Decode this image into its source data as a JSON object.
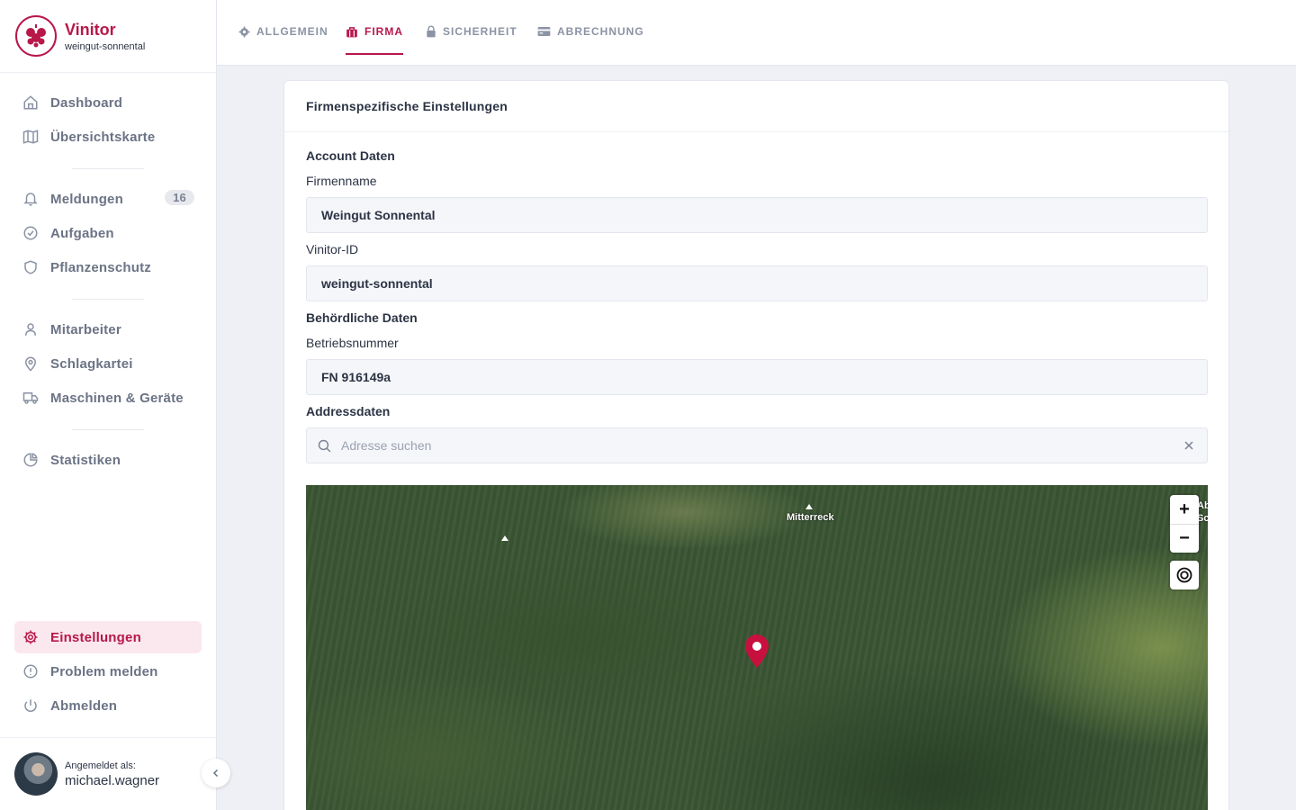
{
  "brand": {
    "name": "Vinitor",
    "account": "weingut-sonnental",
    "logo_icon": "grapes-icon"
  },
  "sidebar": {
    "items": [
      {
        "label": "Dashboard",
        "icon": "home-icon"
      },
      {
        "label": "Übersichtskarte",
        "icon": "map-icon"
      },
      {
        "label": "Meldungen",
        "icon": "bell-icon",
        "badge": "16"
      },
      {
        "label": "Aufgaben",
        "icon": "check-circle-icon"
      },
      {
        "label": "Pflanzenschutz",
        "icon": "shield-icon"
      },
      {
        "label": "Mitarbeiter",
        "icon": "user-icon"
      },
      {
        "label": "Schlagkartei",
        "icon": "location-pin-icon"
      },
      {
        "label": "Maschinen & Geräte",
        "icon": "truck-icon"
      },
      {
        "label": "Statistiken",
        "icon": "pie-chart-icon"
      }
    ],
    "bottom_items": [
      {
        "label": "Einstellungen",
        "icon": "gear-icon",
        "active": true
      },
      {
        "label": "Problem melden",
        "icon": "alert-circle-icon"
      },
      {
        "label": "Abmelden",
        "icon": "power-icon"
      }
    ],
    "user": {
      "caption": "Angemeldet als:",
      "name": "michael.wagner"
    }
  },
  "tabs": [
    {
      "label": "ALLGEMEIN",
      "icon": "gear-icon"
    },
    {
      "label": "FIRMA",
      "icon": "briefcase-icon",
      "active": true
    },
    {
      "label": "SICHERHEIT",
      "icon": "lock-icon"
    },
    {
      "label": "ABRECHNUNG",
      "icon": "credit-card-icon"
    }
  ],
  "card": {
    "title": "Firmenspezifische Einstellungen",
    "account_section": "Account Daten",
    "company_name_label": "Firmenname",
    "company_name_value": "Weingut Sonnental",
    "vinitor_id_label": "Vinitor-ID",
    "vinitor_id_value": "weingut-sonnental",
    "authority_section": "Behördliche Daten",
    "business_number_label": "Betriebsnummer",
    "business_number_value": "FN 916149a",
    "address_section": "Addressdaten",
    "address_placeholder": "Adresse suchen"
  },
  "map": {
    "labels": {
      "peak_1": "Mitterreck",
      "edge_1": "Ab",
      "edge_2": "Sc"
    },
    "zoom_in": "+",
    "zoom_out": "−",
    "marker_color": "#c8103e"
  },
  "colors": {
    "accent": "#b8174a",
    "active_bg": "#fbe8ee"
  }
}
